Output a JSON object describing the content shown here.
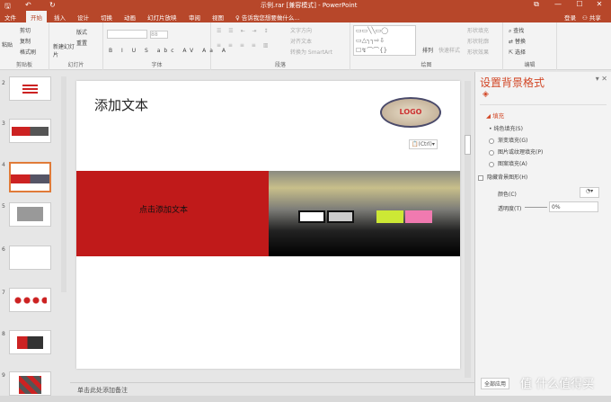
{
  "window": {
    "title": "示例.rar [兼容模式] - PowerPoint",
    "controls": [
      "⧉",
      "—",
      "☐",
      "✕"
    ]
  },
  "tabs": [
    "文件",
    "开始",
    "插入",
    "设计",
    "切换",
    "动画",
    "幻灯片放映",
    "审阅",
    "视图"
  ],
  "active_tab": "开始",
  "tell_me": "告诉我您想要做什么...",
  "account": {
    "login": "登录",
    "share": "共享"
  },
  "ribbon": {
    "clipboard": {
      "label": "剪贴板",
      "paste": "粘贴",
      "cut": "剪切",
      "copy": "复制",
      "format_painter": "格式刷"
    },
    "slides": {
      "label": "幻灯片",
      "new_slide": "新建幻灯片",
      "layout": "版式",
      "reset": "重置"
    },
    "font": {
      "label": "字体",
      "size": "88"
    },
    "paragraph": {
      "label": "段落",
      "text_direction": "文字方向",
      "align_text": "对齐文本",
      "smartart": "转换为 SmartArt"
    },
    "drawing": {
      "label": "绘图",
      "arrange": "排列",
      "quick_styles": "快速样式",
      "shape_fill": "形状填充",
      "shape_outline": "形状轮廓",
      "shape_effects": "形状效果"
    },
    "editing": {
      "label": "编辑",
      "find": "查找",
      "replace": "替换",
      "select": "选择"
    }
  },
  "thumbnails": [
    {
      "n": "2"
    },
    {
      "n": "3"
    },
    {
      "n": "4",
      "selected": true
    },
    {
      "n": "5"
    },
    {
      "n": "6"
    },
    {
      "n": "7"
    },
    {
      "n": "8"
    },
    {
      "n": "9"
    }
  ],
  "slide": {
    "title": "添加文本",
    "logo": "LOGO",
    "paste_tag": "(Ctrl)",
    "band_text": "点击添加文本"
  },
  "notes_placeholder": "单击此处添加备注",
  "format_pane": {
    "title": "设置背景格式",
    "section": "填充",
    "options": [
      "纯色填充(S)",
      "渐变填充(G)",
      "图片或纹理填充(P)",
      "图案填充(A)"
    ],
    "hide_bg": "隐藏背景图形(H)",
    "color_label": "颜色(C)",
    "transparency_label": "透明度(T)",
    "transparency_value": "0%",
    "apply_all": "全部应用"
  },
  "watermark": "值 什么值得买",
  "accent": "#b7472a"
}
